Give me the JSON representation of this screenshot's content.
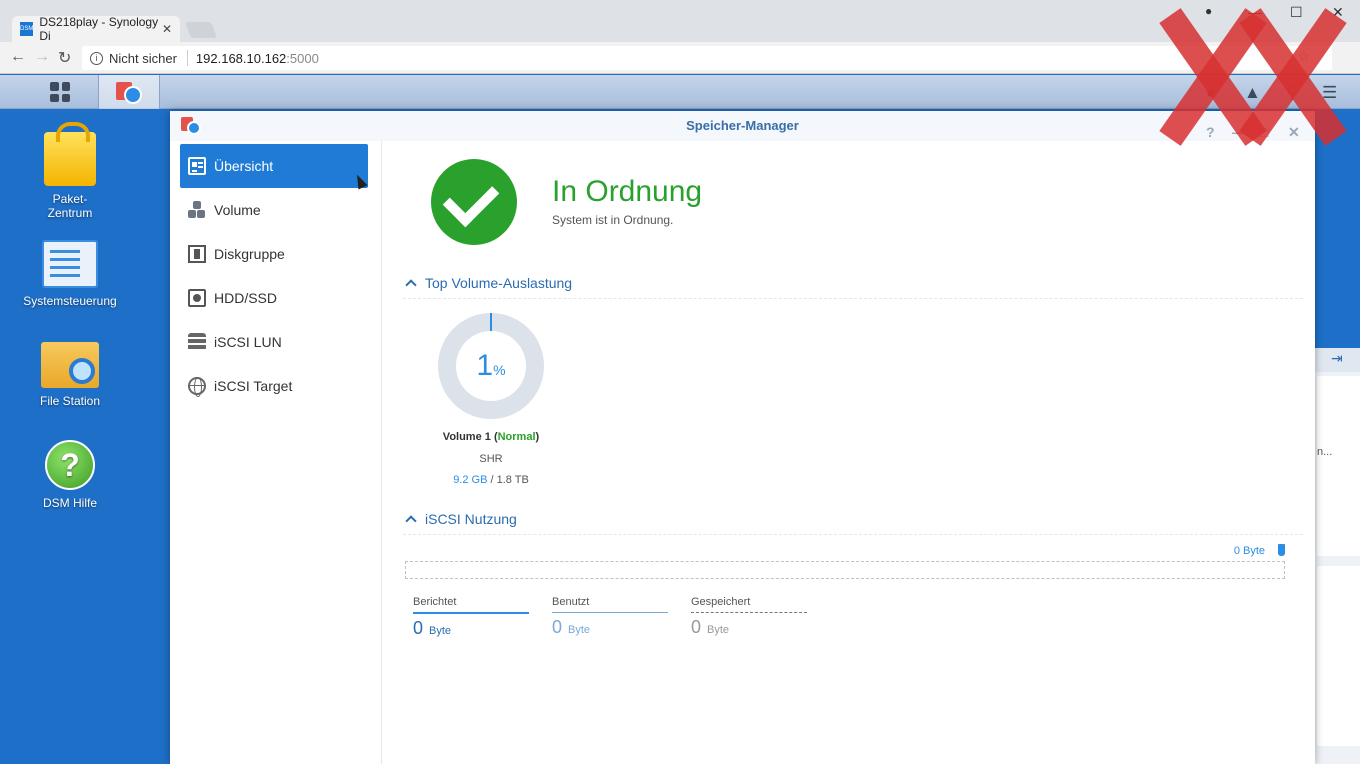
{
  "browser": {
    "tab_title": "DS218play - Synology Di",
    "tab_favicon": "DSM",
    "tab_close": "✕",
    "win_minimize": "—",
    "win_maximize": "☐",
    "win_close": "✕",
    "insecure_label": "Nicht sicher",
    "url_host": "192.168.10.162",
    "url_port": ":5000"
  },
  "desktop": {
    "icons": [
      {
        "label": "Paket-\nZentrum"
      },
      {
        "label": "Systemsteuerung"
      },
      {
        "label": "File Station"
      },
      {
        "label": "DSM Hilfe"
      }
    ],
    "help_glyph": "?"
  },
  "window": {
    "title": "Speicher-Manager",
    "help": "?",
    "minimize": "—",
    "maximize": "□",
    "close": "✕"
  },
  "sidebar": {
    "items": [
      {
        "label": "Übersicht",
        "icon": "overview-icon"
      },
      {
        "label": "Volume",
        "icon": "volume-icon"
      },
      {
        "label": "Diskgruppe",
        "icon": "diskgroup-icon"
      },
      {
        "label": "HDD/SSD",
        "icon": "hdd-icon"
      },
      {
        "label": "iSCSI LUN",
        "icon": "lun-icon"
      },
      {
        "label": "iSCSI Target",
        "icon": "target-icon"
      }
    ]
  },
  "status": {
    "title": "In Ordnung",
    "subtitle": "System ist in Ordnung.",
    "color": "#2aa12c"
  },
  "volume_section": {
    "title": "Top Volume-Auslastung",
    "usage_value": "1",
    "usage_unit": "%",
    "name": "Volume 1 (",
    "state": "Normal",
    "name_close": ")",
    "type": "SHR",
    "used": "9.2 GB",
    "total": " / 1.8 TB"
  },
  "iscsi_section": {
    "title": "iSCSI Nutzung",
    "bar_label": "0 Byte",
    "stats": [
      {
        "label": "Berichtet",
        "value": "0",
        "unit": "Byte"
      },
      {
        "label": "Benutzt",
        "value": "0",
        "unit": "Byte"
      },
      {
        "label": "Gespeichert",
        "value": "0",
        "unit": "Byte"
      }
    ]
  },
  "background_window": {
    "truncated_text": "n..."
  }
}
